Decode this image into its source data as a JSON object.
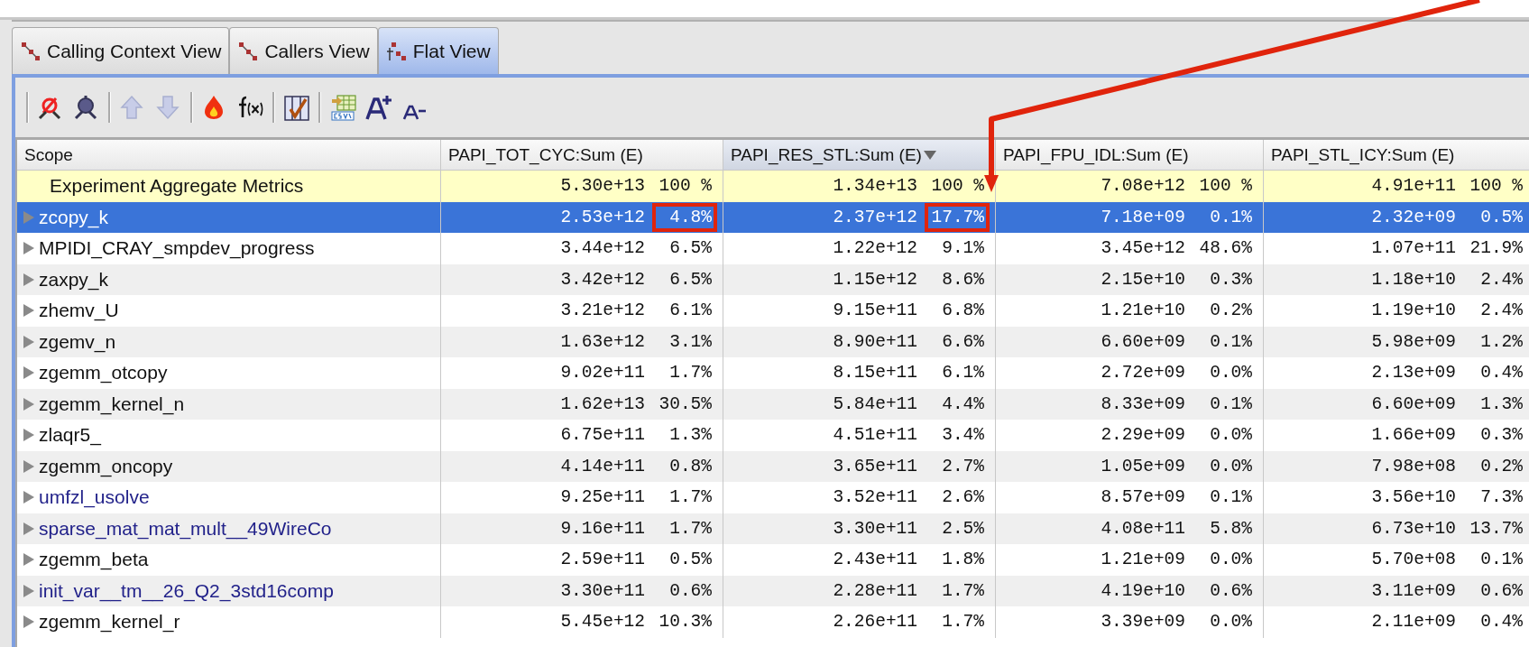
{
  "tabs": [
    {
      "label": "Calling Context View",
      "kind": "cct",
      "selected": false
    },
    {
      "label": "Callers View",
      "kind": "callers",
      "selected": false
    },
    {
      "label": "Flat View",
      "kind": "flat",
      "selected": true
    }
  ],
  "toolbar": [
    {
      "kind": "sep"
    },
    {
      "kind": "zoom-out"
    },
    {
      "kind": "zoom-in"
    },
    {
      "kind": "sep"
    },
    {
      "kind": "up"
    },
    {
      "kind": "down"
    },
    {
      "kind": "sep"
    },
    {
      "kind": "flame"
    },
    {
      "kind": "fx"
    },
    {
      "kind": "sep"
    },
    {
      "kind": "columns"
    },
    {
      "kind": "sep"
    },
    {
      "kind": "csv"
    },
    {
      "kind": "font-up"
    },
    {
      "kind": "font-down"
    }
  ],
  "table": {
    "columns": [
      {
        "label": "Scope",
        "sorted": false
      },
      {
        "label": "PAPI_TOT_CYC:Sum (E)",
        "sorted": false
      },
      {
        "label": "PAPI_RES_STL:Sum (E)",
        "sorted": true
      },
      {
        "label": "PAPI_FPU_IDL:Sum (E)",
        "sorted": false
      },
      {
        "label": "PAPI_STL_ICY:Sum (E)",
        "sorted": false
      }
    ],
    "rows": [
      {
        "scope": "Experiment Aggregate Metrics",
        "kind": "aggregate",
        "selected": false,
        "metrics": [
          {
            "value": "5.30e+13",
            "percent": "100 %",
            "boxed": false
          },
          {
            "value": "1.34e+13",
            "percent": "100 %",
            "boxed": false
          },
          {
            "value": "7.08e+12",
            "percent": "100 %",
            "boxed": false
          },
          {
            "value": "4.91e+11",
            "percent": "100 %",
            "boxed": false
          }
        ]
      },
      {
        "scope": "zcopy_k",
        "kind": "plain",
        "selected": true,
        "metrics": [
          {
            "value": "2.53e+12",
            "percent": "4.8%",
            "boxed": true
          },
          {
            "value": "2.37e+12",
            "percent": "17.7%",
            "boxed": true
          },
          {
            "value": "7.18e+09",
            "percent": "0.1%",
            "boxed": false
          },
          {
            "value": "2.32e+09",
            "percent": "0.5%",
            "boxed": false
          }
        ]
      },
      {
        "scope": "MPIDI_CRAY_smpdev_progress",
        "kind": "plain",
        "selected": false,
        "metrics": [
          {
            "value": "3.44e+12",
            "percent": "6.5%",
            "boxed": false
          },
          {
            "value": "1.22e+12",
            "percent": "9.1%",
            "boxed": false
          },
          {
            "value": "3.45e+12",
            "percent": "48.6%",
            "boxed": false
          },
          {
            "value": "1.07e+11",
            "percent": "21.9%",
            "boxed": false
          }
        ]
      },
      {
        "scope": "zaxpy_k",
        "kind": "plain",
        "selected": false,
        "metrics": [
          {
            "value": "3.42e+12",
            "percent": "6.5%",
            "boxed": false
          },
          {
            "value": "1.15e+12",
            "percent": "8.6%",
            "boxed": false
          },
          {
            "value": "2.15e+10",
            "percent": "0.3%",
            "boxed": false
          },
          {
            "value": "1.18e+10",
            "percent": "2.4%",
            "boxed": false
          }
        ]
      },
      {
        "scope": "zhemv_U",
        "kind": "plain",
        "selected": false,
        "metrics": [
          {
            "value": "3.21e+12",
            "percent": "6.1%",
            "boxed": false
          },
          {
            "value": "9.15e+11",
            "percent": "6.8%",
            "boxed": false
          },
          {
            "value": "1.21e+10",
            "percent": "0.2%",
            "boxed": false
          },
          {
            "value": "1.19e+10",
            "percent": "2.4%",
            "boxed": false
          }
        ]
      },
      {
        "scope": "zgemv_n",
        "kind": "plain",
        "selected": false,
        "metrics": [
          {
            "value": "1.63e+12",
            "percent": "3.1%",
            "boxed": false
          },
          {
            "value": "8.90e+11",
            "percent": "6.6%",
            "boxed": false
          },
          {
            "value": "6.60e+09",
            "percent": "0.1%",
            "boxed": false
          },
          {
            "value": "5.98e+09",
            "percent": "1.2%",
            "boxed": false
          }
        ]
      },
      {
        "scope": "zgemm_otcopy",
        "kind": "plain",
        "selected": false,
        "metrics": [
          {
            "value": "9.02e+11",
            "percent": "1.7%",
            "boxed": false
          },
          {
            "value": "8.15e+11",
            "percent": "6.1%",
            "boxed": false
          },
          {
            "value": "2.72e+09",
            "percent": "0.0%",
            "boxed": false
          },
          {
            "value": "2.13e+09",
            "percent": "0.4%",
            "boxed": false
          }
        ]
      },
      {
        "scope": "zgemm_kernel_n",
        "kind": "plain",
        "selected": false,
        "metrics": [
          {
            "value": "1.62e+13",
            "percent": "30.5%",
            "boxed": false
          },
          {
            "value": "5.84e+11",
            "percent": "4.4%",
            "boxed": false
          },
          {
            "value": "8.33e+09",
            "percent": "0.1%",
            "boxed": false
          },
          {
            "value": "6.60e+09",
            "percent": "1.3%",
            "boxed": false
          }
        ]
      },
      {
        "scope": "zlaqr5_",
        "kind": "plain",
        "selected": false,
        "metrics": [
          {
            "value": "6.75e+11",
            "percent": "1.3%",
            "boxed": false
          },
          {
            "value": "4.51e+11",
            "percent": "3.4%",
            "boxed": false
          },
          {
            "value": "2.29e+09",
            "percent": "0.0%",
            "boxed": false
          },
          {
            "value": "1.66e+09",
            "percent": "0.3%",
            "boxed": false
          }
        ]
      },
      {
        "scope": "zgemm_oncopy",
        "kind": "plain",
        "selected": false,
        "metrics": [
          {
            "value": "4.14e+11",
            "percent": "0.8%",
            "boxed": false
          },
          {
            "value": "3.65e+11",
            "percent": "2.7%",
            "boxed": false
          },
          {
            "value": "1.05e+09",
            "percent": "0.0%",
            "boxed": false
          },
          {
            "value": "7.98e+08",
            "percent": "0.2%",
            "boxed": false
          }
        ]
      },
      {
        "scope": "umfzl_usolve",
        "kind": "linked",
        "selected": false,
        "metrics": [
          {
            "value": "9.25e+11",
            "percent": "1.7%",
            "boxed": false
          },
          {
            "value": "3.52e+11",
            "percent": "2.6%",
            "boxed": false
          },
          {
            "value": "8.57e+09",
            "percent": "0.1%",
            "boxed": false
          },
          {
            "value": "3.56e+10",
            "percent": "7.3%",
            "boxed": false
          }
        ]
      },
      {
        "scope": "sparse_mat_mat_mult__49WireCo",
        "kind": "linked",
        "selected": false,
        "metrics": [
          {
            "value": "9.16e+11",
            "percent": "1.7%",
            "boxed": false
          },
          {
            "value": "3.30e+11",
            "percent": "2.5%",
            "boxed": false
          },
          {
            "value": "4.08e+11",
            "percent": "5.8%",
            "boxed": false
          },
          {
            "value": "6.73e+10",
            "percent": "13.7%",
            "boxed": false
          }
        ]
      },
      {
        "scope": "zgemm_beta",
        "kind": "plain",
        "selected": false,
        "metrics": [
          {
            "value": "2.59e+11",
            "percent": "0.5%",
            "boxed": false
          },
          {
            "value": "2.43e+11",
            "percent": "1.8%",
            "boxed": false
          },
          {
            "value": "1.21e+09",
            "percent": "0.0%",
            "boxed": false
          },
          {
            "value": "5.70e+08",
            "percent": "0.1%",
            "boxed": false
          }
        ]
      },
      {
        "scope": "init_var__tm__26_Q2_3std16comp",
        "kind": "linked",
        "selected": false,
        "metrics": [
          {
            "value": "3.30e+11",
            "percent": "0.6%",
            "boxed": false
          },
          {
            "value": "2.28e+11",
            "percent": "1.7%",
            "boxed": false
          },
          {
            "value": "4.19e+10",
            "percent": "0.6%",
            "boxed": false
          },
          {
            "value": "3.11e+09",
            "percent": "0.6%",
            "boxed": false
          }
        ]
      },
      {
        "scope": "zgemm_kernel_r",
        "kind": "plain",
        "selected": false,
        "metrics": [
          {
            "value": "5.45e+12",
            "percent": "10.3%",
            "boxed": false
          },
          {
            "value": "2.26e+11",
            "percent": "1.7%",
            "boxed": false
          },
          {
            "value": "3.39e+09",
            "percent": "0.0%",
            "boxed": false
          },
          {
            "value": "2.11e+09",
            "percent": "0.4%",
            "boxed": false
          }
        ]
      }
    ]
  }
}
